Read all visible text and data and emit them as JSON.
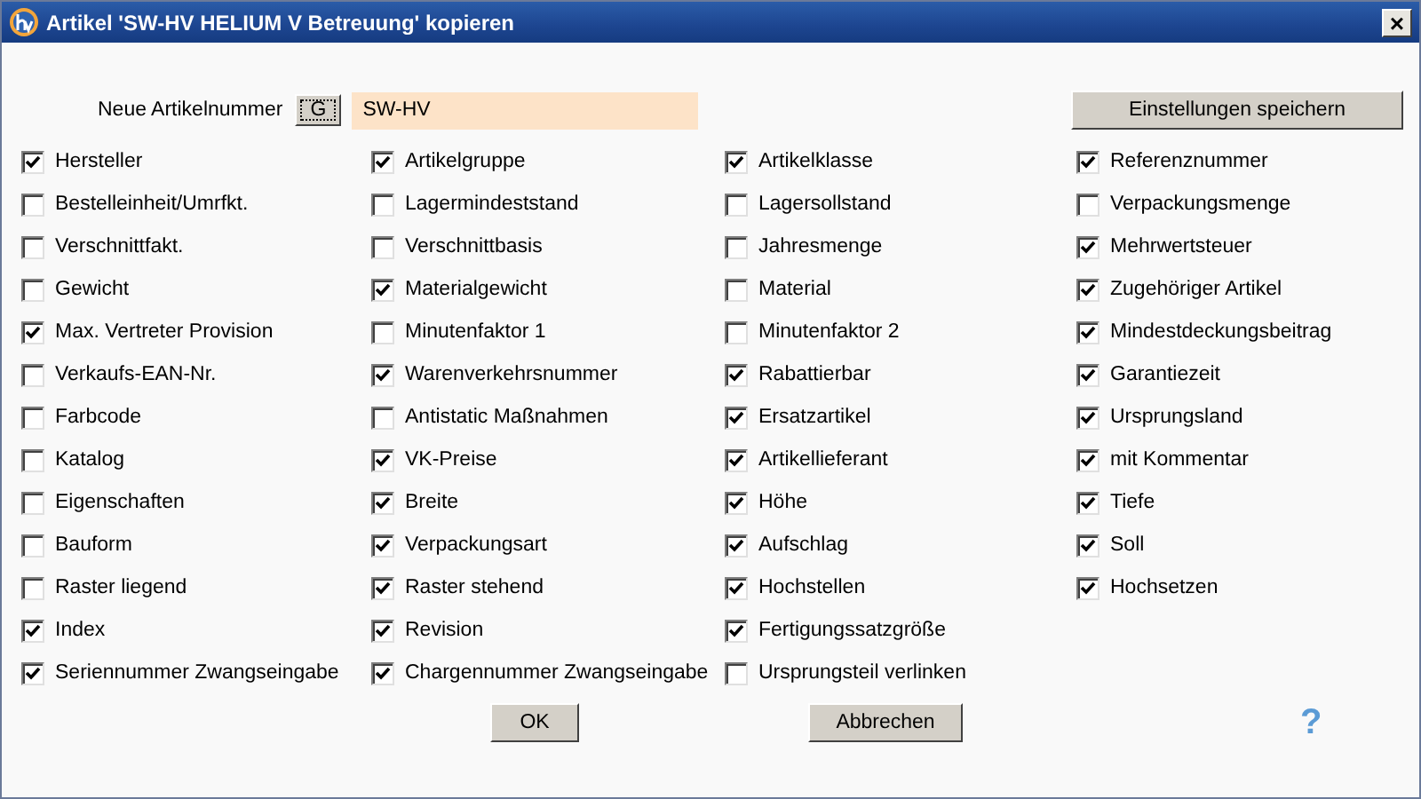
{
  "window": {
    "title": "Artikel 'SW-HV HELIUM V Betreuung' kopieren",
    "close": "×"
  },
  "article_number": {
    "label": "Neue Artikelnummer",
    "generate_button": "G",
    "value": "SW-HV"
  },
  "save_button": "Einstellungen speichern",
  "columns": [
    [
      {
        "label": "Hersteller",
        "checked": true
      },
      {
        "label": "Bestelleinheit/Umrfkt.",
        "checked": false
      },
      {
        "label": "Verschnittfakt.",
        "checked": false
      },
      {
        "label": "Gewicht",
        "checked": false
      },
      {
        "label": "Max. Vertreter Provision",
        "checked": true
      },
      {
        "label": "Verkaufs-EAN-Nr.",
        "checked": false
      },
      {
        "label": "Farbcode",
        "checked": false
      },
      {
        "label": "Katalog",
        "checked": false
      },
      {
        "label": "Eigenschaften",
        "checked": false
      },
      {
        "label": "Bauform",
        "checked": false
      },
      {
        "label": "Raster liegend",
        "checked": false
      },
      {
        "label": "Index",
        "checked": true
      },
      {
        "label": "Seriennummer Zwangseingabe",
        "checked": true
      }
    ],
    [
      {
        "label": "Artikelgruppe",
        "checked": true
      },
      {
        "label": "Lagermindeststand",
        "checked": false
      },
      {
        "label": "Verschnittbasis",
        "checked": false
      },
      {
        "label": "Materialgewicht",
        "checked": true
      },
      {
        "label": "Minutenfaktor 1",
        "checked": false
      },
      {
        "label": "Warenverkehrsnummer",
        "checked": true
      },
      {
        "label": "Antistatic Maßnahmen",
        "checked": false
      },
      {
        "label": "VK-Preise",
        "checked": true
      },
      {
        "label": "Breite",
        "checked": true
      },
      {
        "label": "Verpackungsart",
        "checked": true
      },
      {
        "label": "Raster stehend",
        "checked": true
      },
      {
        "label": "Revision",
        "checked": true
      },
      {
        "label": "Chargennummer Zwangseingabe",
        "checked": true
      }
    ],
    [
      {
        "label": "Artikelklasse",
        "checked": true
      },
      {
        "label": "Lagersollstand",
        "checked": false
      },
      {
        "label": "Jahresmenge",
        "checked": false
      },
      {
        "label": "Material",
        "checked": false
      },
      {
        "label": "Minutenfaktor 2",
        "checked": false
      },
      {
        "label": "Rabattierbar",
        "checked": true
      },
      {
        "label": "Ersatzartikel",
        "checked": true
      },
      {
        "label": "Artikellieferant",
        "checked": true
      },
      {
        "label": "Höhe",
        "checked": true
      },
      {
        "label": "Aufschlag",
        "checked": true
      },
      {
        "label": "Hochstellen",
        "checked": true
      },
      {
        "label": "Fertigungssatzgröße",
        "checked": true
      },
      {
        "label": "Ursprungsteil verlinken",
        "checked": false
      }
    ],
    [
      {
        "label": "Referenznummer",
        "checked": true
      },
      {
        "label": "Verpackungsmenge",
        "checked": false
      },
      {
        "label": "Mehrwertsteuer",
        "checked": true
      },
      {
        "label": "Zugehöriger Artikel",
        "checked": true
      },
      {
        "label": "Mindestdeckungsbeitrag",
        "checked": true
      },
      {
        "label": "Garantiezeit",
        "checked": true
      },
      {
        "label": "Ursprungsland",
        "checked": true
      },
      {
        "label": "mit Kommentar",
        "checked": true
      },
      {
        "label": "Tiefe",
        "checked": true
      },
      {
        "label": "Soll",
        "checked": true
      },
      {
        "label": "Hochsetzen",
        "checked": true
      }
    ]
  ],
  "buttons": {
    "ok": "OK",
    "cancel": "Abbrechen",
    "help": "?"
  }
}
